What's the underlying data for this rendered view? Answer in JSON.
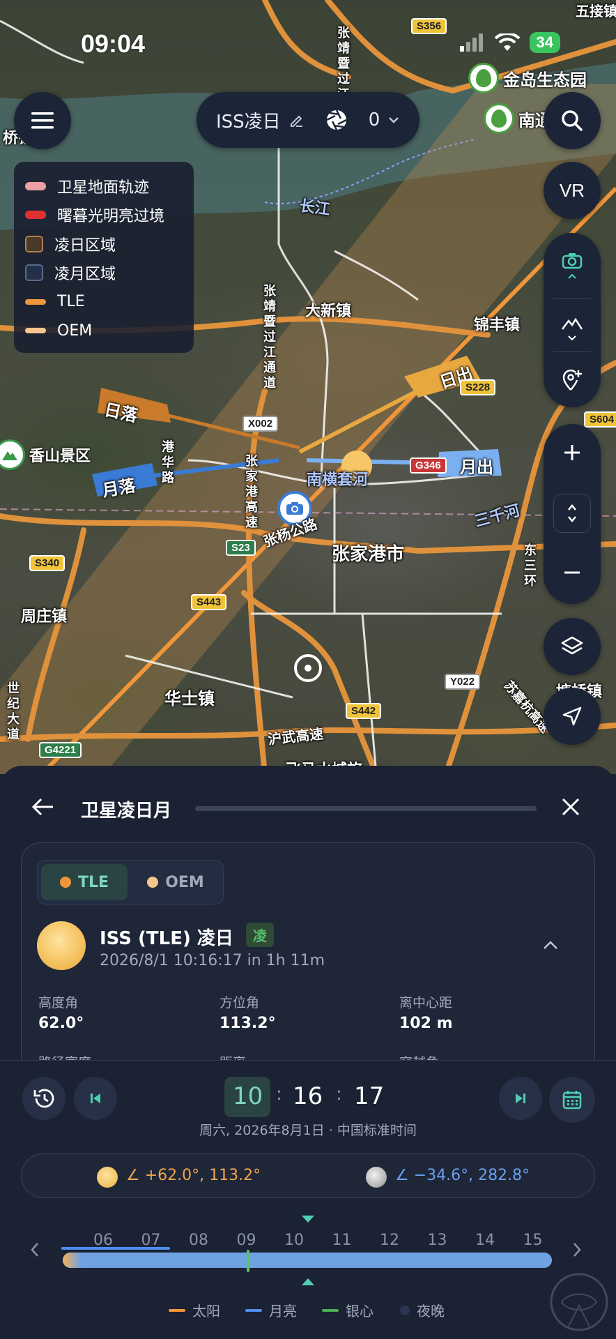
{
  "status": {
    "time": "09:04",
    "battery": "34"
  },
  "top_pill": {
    "title": "ISS凌日",
    "count": "0"
  },
  "legend": [
    {
      "label": "卫星地面轨迹",
      "color": "#e8a0a0",
      "kind": "line"
    },
    {
      "label": "曙暮光明亮过境",
      "color": "#e03030",
      "kind": "line"
    },
    {
      "label": "凌日区域",
      "color": "#4a3a2a",
      "border": "#b08050",
      "kind": "box"
    },
    {
      "label": "凌月区域",
      "color": "#243048",
      "border": "#5a6a90",
      "kind": "box"
    },
    {
      "label": "TLE",
      "color": "#f0963a",
      "kind": "line"
    },
    {
      "label": "OEM",
      "color": "#f6c58e",
      "kind": "line"
    }
  ],
  "map": {
    "places": {
      "jindao": "金岛生态园",
      "nantong": "南通",
      "dazhen": "大新镇",
      "jinfeng": "锦丰镇",
      "xiangshan": "香山景区",
      "zjg": "张家港市",
      "zhouzhuang": "周庄镇",
      "huashi": "华士镇",
      "tangqiao": "塘桥镇",
      "changjiang": "长江",
      "sanqianhe": "三千河",
      "nanhengtao": "南横套河",
      "zhangxian": "张杨公路",
      "huwu": "沪武高速",
      "feima": "飞马水城旅",
      "zhangjing": "张靖暨过江通道",
      "gangtai": "港华路",
      "zhangjiagang_gs": "张家港高速",
      "dongsanhuan": "东三环",
      "sujiajing": "苏嘉杭高速",
      "shiji": "世纪大道",
      "wujie": "五接镇",
      "qiao": "桥镇"
    },
    "roads": {
      "s356": "S356",
      "x002": "X002",
      "s228": "S228",
      "s604": "S604",
      "g346": "G346",
      "s340": "S340",
      "s23": "S23",
      "s443": "S443",
      "s442": "S442",
      "y022": "Y022",
      "g4221": "G4221"
    },
    "flags": {
      "sunset": "日落",
      "sunrise": "日出",
      "moonset": "月落",
      "moonrise": "月出"
    },
    "vr_label": "VR"
  },
  "panel": {
    "title": "卫星凌日月",
    "tabs": [
      {
        "label": "TLE",
        "color": "#f0963a"
      },
      {
        "label": "OEM",
        "color": "#f6c58e"
      }
    ],
    "event": {
      "title": "ISS (TLE) 凌日",
      "badge": "凌",
      "time": "2026/8/1 10:16:17  in 1h 11m"
    },
    "stats": [
      {
        "k": "高度角",
        "v": "62.0°"
      },
      {
        "k": "方位角",
        "v": "113.2°"
      },
      {
        "k": "离中心距",
        "v": "102 m"
      },
      {
        "k": "路径宽度",
        "v": ""
      },
      {
        "k": "距离",
        "v": ""
      },
      {
        "k": "穿越角",
        "v": ""
      }
    ],
    "time": {
      "h": "10",
      "m": "16",
      "s": "17",
      "sub": "周六, 2026年8月1日 · 中国标准时间"
    },
    "sun_pos": "∠ +62.0°, 113.2°",
    "moon_pos": "∠ −34.6°, 282.8°",
    "hours": [
      "06",
      "07",
      "08",
      "09",
      "10",
      "11",
      "12",
      "13",
      "14",
      "15"
    ],
    "legend": [
      {
        "label": "太阳",
        "color": "#f0963a"
      },
      {
        "label": "月亮",
        "color": "#4f8ef0"
      },
      {
        "label": "银心",
        "color": "#4caf50"
      },
      {
        "label": "夜晚",
        "color": "#2a3552"
      }
    ]
  }
}
